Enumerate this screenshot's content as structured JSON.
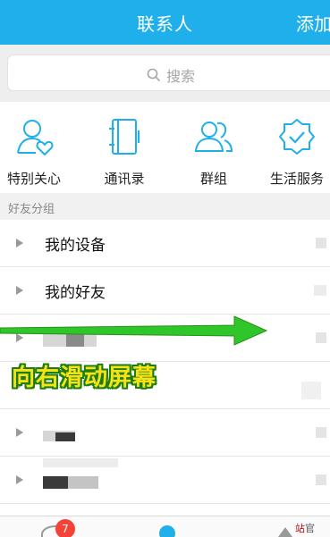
{
  "header": {
    "title": "联系人",
    "add_label": "添加"
  },
  "search": {
    "placeholder": "搜索"
  },
  "quick_actions": [
    {
      "label": "特别关心",
      "icon": "special-care-icon"
    },
    {
      "label": "通讯录",
      "icon": "address-book-icon"
    },
    {
      "label": "群组",
      "icon": "group-icon"
    },
    {
      "label": "生活服务",
      "icon": "life-service-icon"
    }
  ],
  "section": {
    "title": "好友分组"
  },
  "groups": [
    {
      "name": "我的设备"
    },
    {
      "name": "我的好友"
    }
  ],
  "overlay": {
    "instruction": "向右滑动屏幕"
  },
  "tabbar": {
    "message_badge": "7"
  },
  "watermark": {
    "part1": "站",
    "part2": "官"
  },
  "colors": {
    "accent": "#1fb0ec",
    "arrow_green": "#2fc62a",
    "instruction_fill": "#f7e218"
  }
}
